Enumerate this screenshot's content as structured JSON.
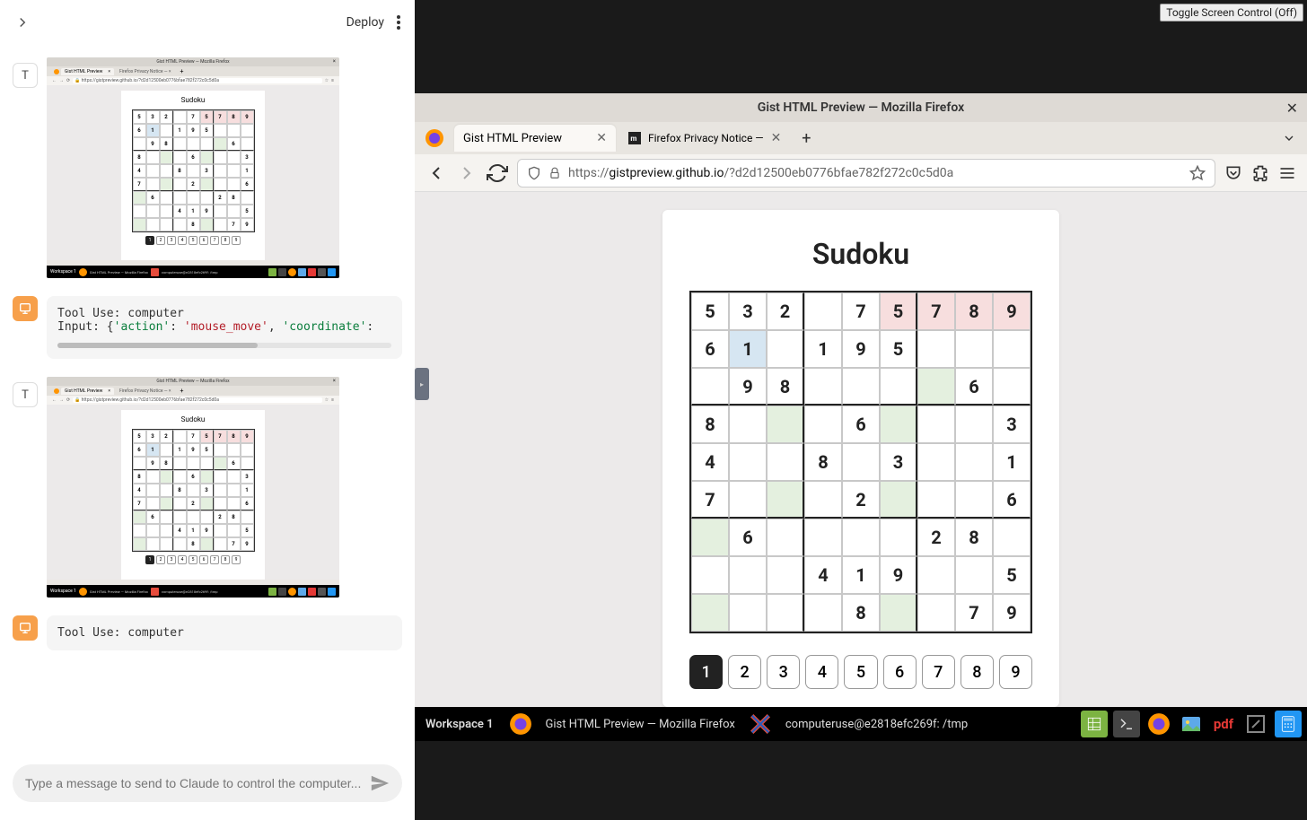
{
  "left": {
    "deploy": "Deploy",
    "avatar_letter": "T",
    "tool1": {
      "line1": "Tool Use: computer",
      "line2_prefix": "Input: {",
      "action_key": "'action'",
      "action_val": "'mouse_move'",
      "coord_key": "'coordinate'",
      "sep": ": ",
      "comma": ", "
    },
    "tool2": {
      "line1": "Tool Use: computer"
    },
    "input_placeholder": "Type a message to send to Claude to control the computer...",
    "thumb": {
      "title": "Gist HTML Preview — Mozilla Firefox",
      "tab1": "Gist HTML Preview",
      "tab2": "Firefox Privacy Notice —",
      "url": "https://gistpreview.github.io/?d2d12500eb0776bfae782f272c0c5d0a",
      "sudoku": "Sudoku",
      "ws": "Workspace 1",
      "task": "Gist HTML Preview — Mozilla Firefox",
      "user": "computeruse@e2818efc269f: /tmp"
    }
  },
  "right": {
    "toggle": "Toggle Screen Control (Off)",
    "ff_title": "Gist HTML Preview — Mozilla Firefox",
    "tab1": "Gist HTML Preview",
    "tab2": "Firefox Privacy Notice —",
    "url_domain": "gistpreview.github.io",
    "url_prefix": "https://",
    "url_path": "/?d2d12500eb0776bfae782f272c0c5d0a",
    "sudoku_title": "Sudoku",
    "grid": [
      [
        "5",
        "3",
        "2",
        "",
        "7",
        "5",
        "7",
        "8",
        "9"
      ],
      [
        "6",
        "1",
        "",
        "1",
        "9",
        "5",
        "",
        "",
        ""
      ],
      [
        "",
        "9",
        "8",
        "",
        "",
        "",
        "",
        "6",
        ""
      ],
      [
        "8",
        "",
        "",
        "",
        "6",
        "",
        "",
        "",
        "3"
      ],
      [
        "4",
        "",
        "",
        "8",
        "",
        "3",
        "",
        "",
        "1"
      ],
      [
        "7",
        "",
        "",
        "",
        "2",
        "",
        "",
        "",
        "6"
      ],
      [
        "",
        "6",
        "",
        "",
        "",
        "",
        "2",
        "8",
        ""
      ],
      [
        "",
        "",
        "",
        "4",
        "1",
        "9",
        "",
        "",
        "5"
      ],
      [
        "",
        "",
        "",
        "",
        "8",
        "",
        "",
        "7",
        "9"
      ]
    ],
    "cell_bg": [
      [
        "",
        "",
        "",
        "",
        "",
        "pink",
        "pink",
        "pink",
        "pink"
      ],
      [
        "",
        "blue",
        "",
        "",
        "",
        "",
        "",
        "",
        ""
      ],
      [
        "",
        "",
        "",
        "",
        "",
        "",
        "green",
        "",
        ""
      ],
      [
        "",
        "",
        "green",
        "",
        "",
        "green",
        "",
        "",
        ""
      ],
      [
        "",
        "",
        "",
        "",
        "",
        "",
        "",
        "",
        ""
      ],
      [
        "",
        "",
        "green",
        "",
        "",
        "green",
        "",
        "",
        ""
      ],
      [
        "green",
        "",
        "",
        "",
        "",
        "",
        "",
        "",
        ""
      ],
      [
        "",
        "",
        "",
        "",
        "",
        "",
        "",
        "",
        ""
      ],
      [
        "green",
        "",
        "",
        "",
        "",
        "green",
        "",
        "",
        ""
      ]
    ],
    "numbers": [
      "1",
      "2",
      "3",
      "4",
      "5",
      "6",
      "7",
      "8",
      "9"
    ],
    "active_number": 0,
    "taskbar": {
      "ws": "Workspace 1",
      "task": "Gist HTML Preview — Mozilla Firefox",
      "user": "computeruse@e2818efc269f: /tmp",
      "pdf": "pdf"
    }
  }
}
